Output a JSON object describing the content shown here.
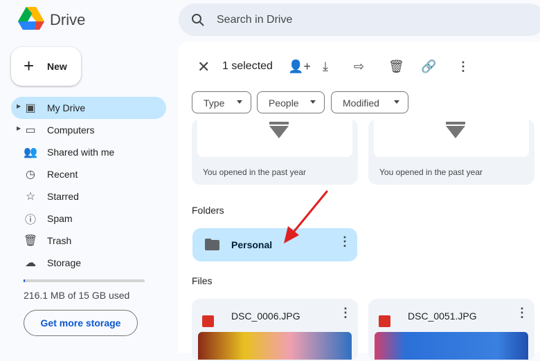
{
  "app": {
    "name": "Drive"
  },
  "search": {
    "placeholder": "Search in Drive"
  },
  "sidebar": {
    "new_label": "New",
    "items": [
      {
        "label": "My Drive",
        "icon": "my-drive-icon",
        "active": true
      },
      {
        "label": "Computers",
        "icon": "computers-icon"
      },
      {
        "label": "Shared with me",
        "icon": "people-icon"
      },
      {
        "label": "Recent",
        "icon": "clock-icon"
      },
      {
        "label": "Starred",
        "icon": "star-icon"
      },
      {
        "label": "Spam",
        "icon": "spam-icon"
      },
      {
        "label": "Trash",
        "icon": "trash-icon"
      },
      {
        "label": "Storage",
        "icon": "cloud-icon"
      }
    ],
    "storage": {
      "text": "216.1 MB of 15 GB used",
      "used_fraction": 0.014,
      "button": "Get more storage"
    }
  },
  "toolbar": {
    "selected": "1 selected"
  },
  "filters": [
    "Type",
    "People",
    "Modified"
  ],
  "suggested": [
    {
      "caption": "You opened in the past year"
    },
    {
      "caption": "You opened in the past year"
    }
  ],
  "folders": {
    "heading": "Folders",
    "items": [
      {
        "name": "Personal"
      }
    ]
  },
  "files": {
    "heading": "Files",
    "items": [
      {
        "name": "DSC_0006.JPG"
      },
      {
        "name": "DSC_0051.JPG"
      }
    ]
  },
  "colors": {
    "accent": "#0b57d0",
    "selected": "#c2e7ff",
    "annotation_arrow": "#e02020"
  }
}
